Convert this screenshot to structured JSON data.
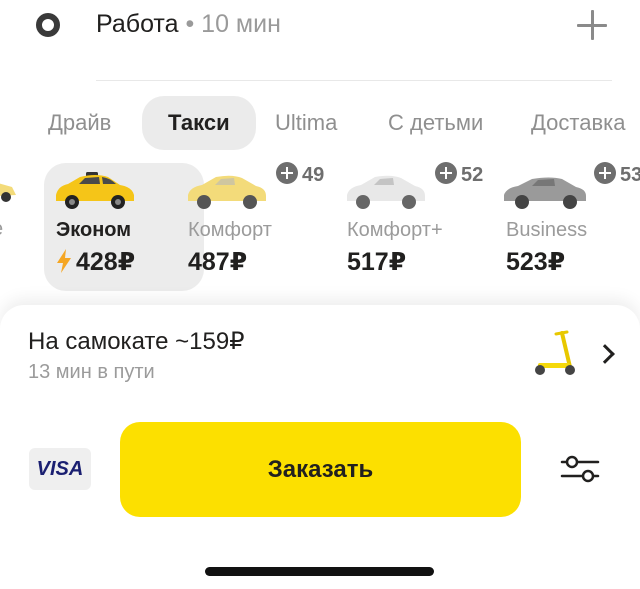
{
  "destination": {
    "title": "Работа",
    "separator": "•",
    "time": "10 мин"
  },
  "tabs": [
    {
      "label": "Драйв",
      "active": false
    },
    {
      "label": "Такси",
      "active": true
    },
    {
      "label": "Ultima",
      "active": false
    },
    {
      "label": "С детьми",
      "active": false
    },
    {
      "label": "Доставка",
      "active": false
    }
  ],
  "tariffs": [
    {
      "name": "Эконом",
      "price": "428₽",
      "selected": true,
      "surge_icon": "bolt-icon",
      "car_color": "#f5c518"
    },
    {
      "name": "Комфорт",
      "price": "487₽",
      "selected": false,
      "plus_points": "49",
      "car_color": "#f3db7a"
    },
    {
      "name": "Комфорт+",
      "price": "517₽",
      "selected": false,
      "plus_points": "52",
      "car_color": "#e6e6e6"
    },
    {
      "name": "Business",
      "price": "523₽",
      "selected": false,
      "plus_points": "53",
      "car_color": "#9a9a9a"
    }
  ],
  "edge_tariff_fragment": "e",
  "scooter": {
    "title": "На самокате ~159₽",
    "subtitle": "13 мин в пути",
    "icon": "scooter-icon"
  },
  "payment": {
    "label": "VISA"
  },
  "order_button": {
    "label": "Заказать"
  },
  "colors": {
    "accent": "#fce000",
    "selected_card_bg": "#ececec",
    "surge": "#f5a623"
  }
}
